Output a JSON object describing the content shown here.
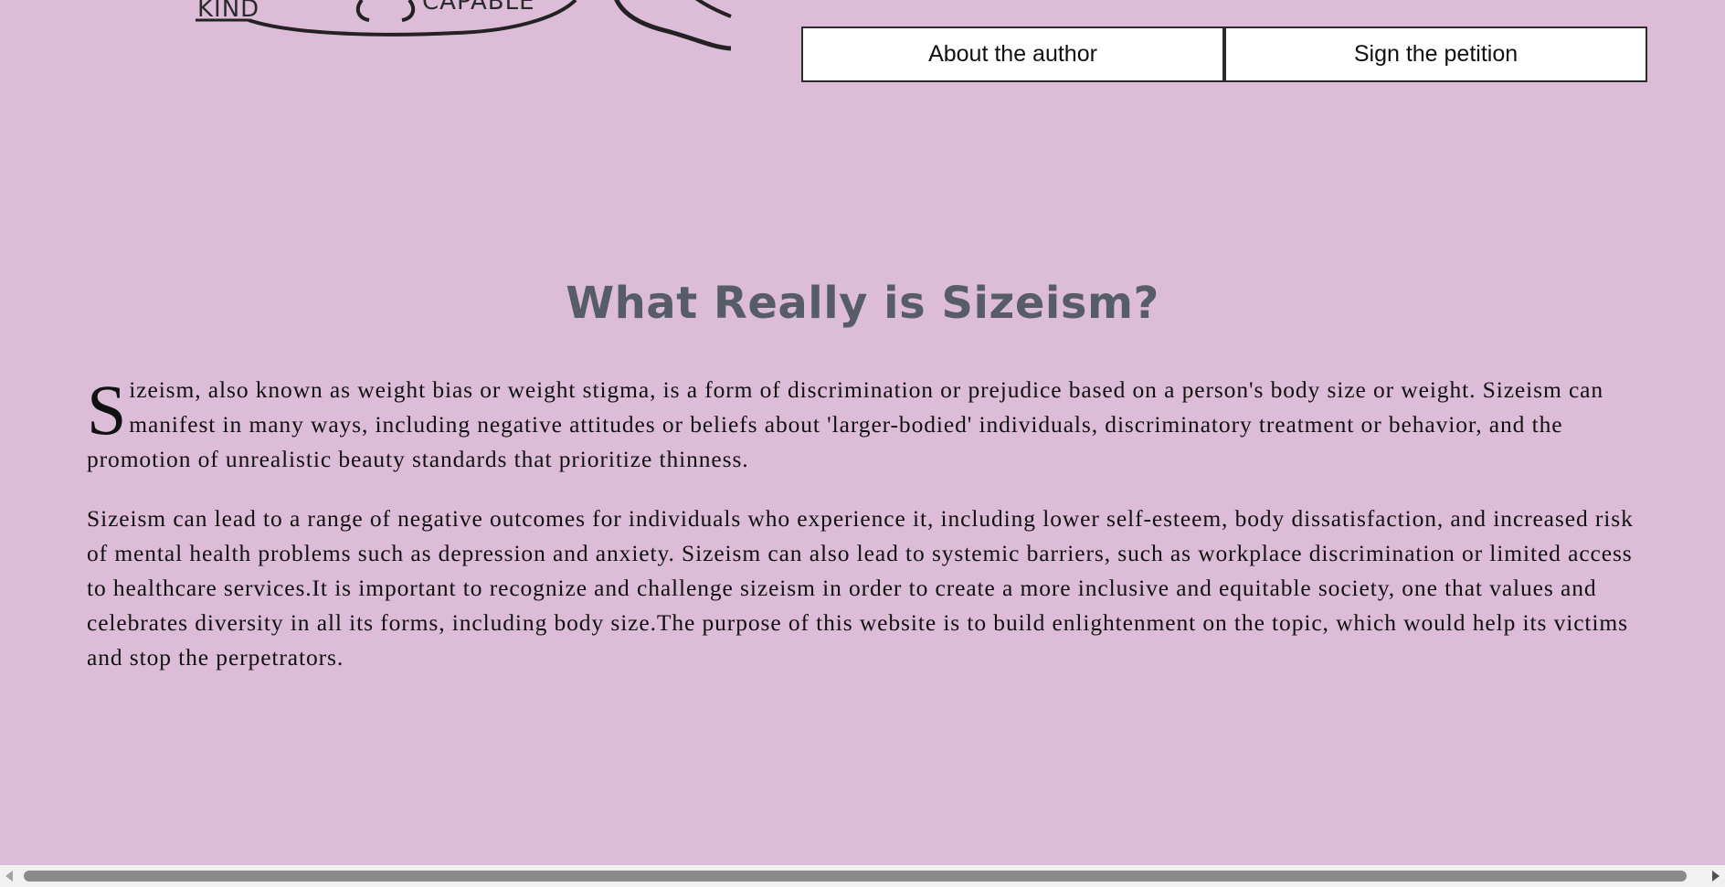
{
  "logo": {
    "word_left": "KIND",
    "word_right": "CAPABLE"
  },
  "nav": {
    "about_label": "About the author",
    "petition_label": "Sign the petition"
  },
  "main": {
    "title": "What Really is Sizeism?",
    "paragraph1_dropcap": "S",
    "paragraph1_rest": "izeism, also known as weight bias or weight stigma, is a form of discrimination or prejudice based on a person's body size or weight. Sizeism can manifest in many ways, including negative attitudes or beliefs about 'larger-bodied' individuals, discriminatory treatment or behavior, and the promotion of unrealistic beauty standards that prioritize thinness.",
    "paragraph2": "Sizeism can lead to a range of negative outcomes for individuals who experience it, including lower self-esteem, body dissatisfaction, and increased risk of mental health problems such as depression and anxiety. Sizeism can also lead to systemic barriers, such as workplace discrimination or limited access to healthcare services.It is important to recognize and challenge sizeism in order to create a more inclusive and equitable society, one that values and celebrates diversity in all its forms, including body size.The purpose of this website is to build enlightenment on the topic, which would help its victims and stop the perpetrators."
  },
  "colors": {
    "background": "#dcbcd6",
    "title": "#565d66"
  }
}
